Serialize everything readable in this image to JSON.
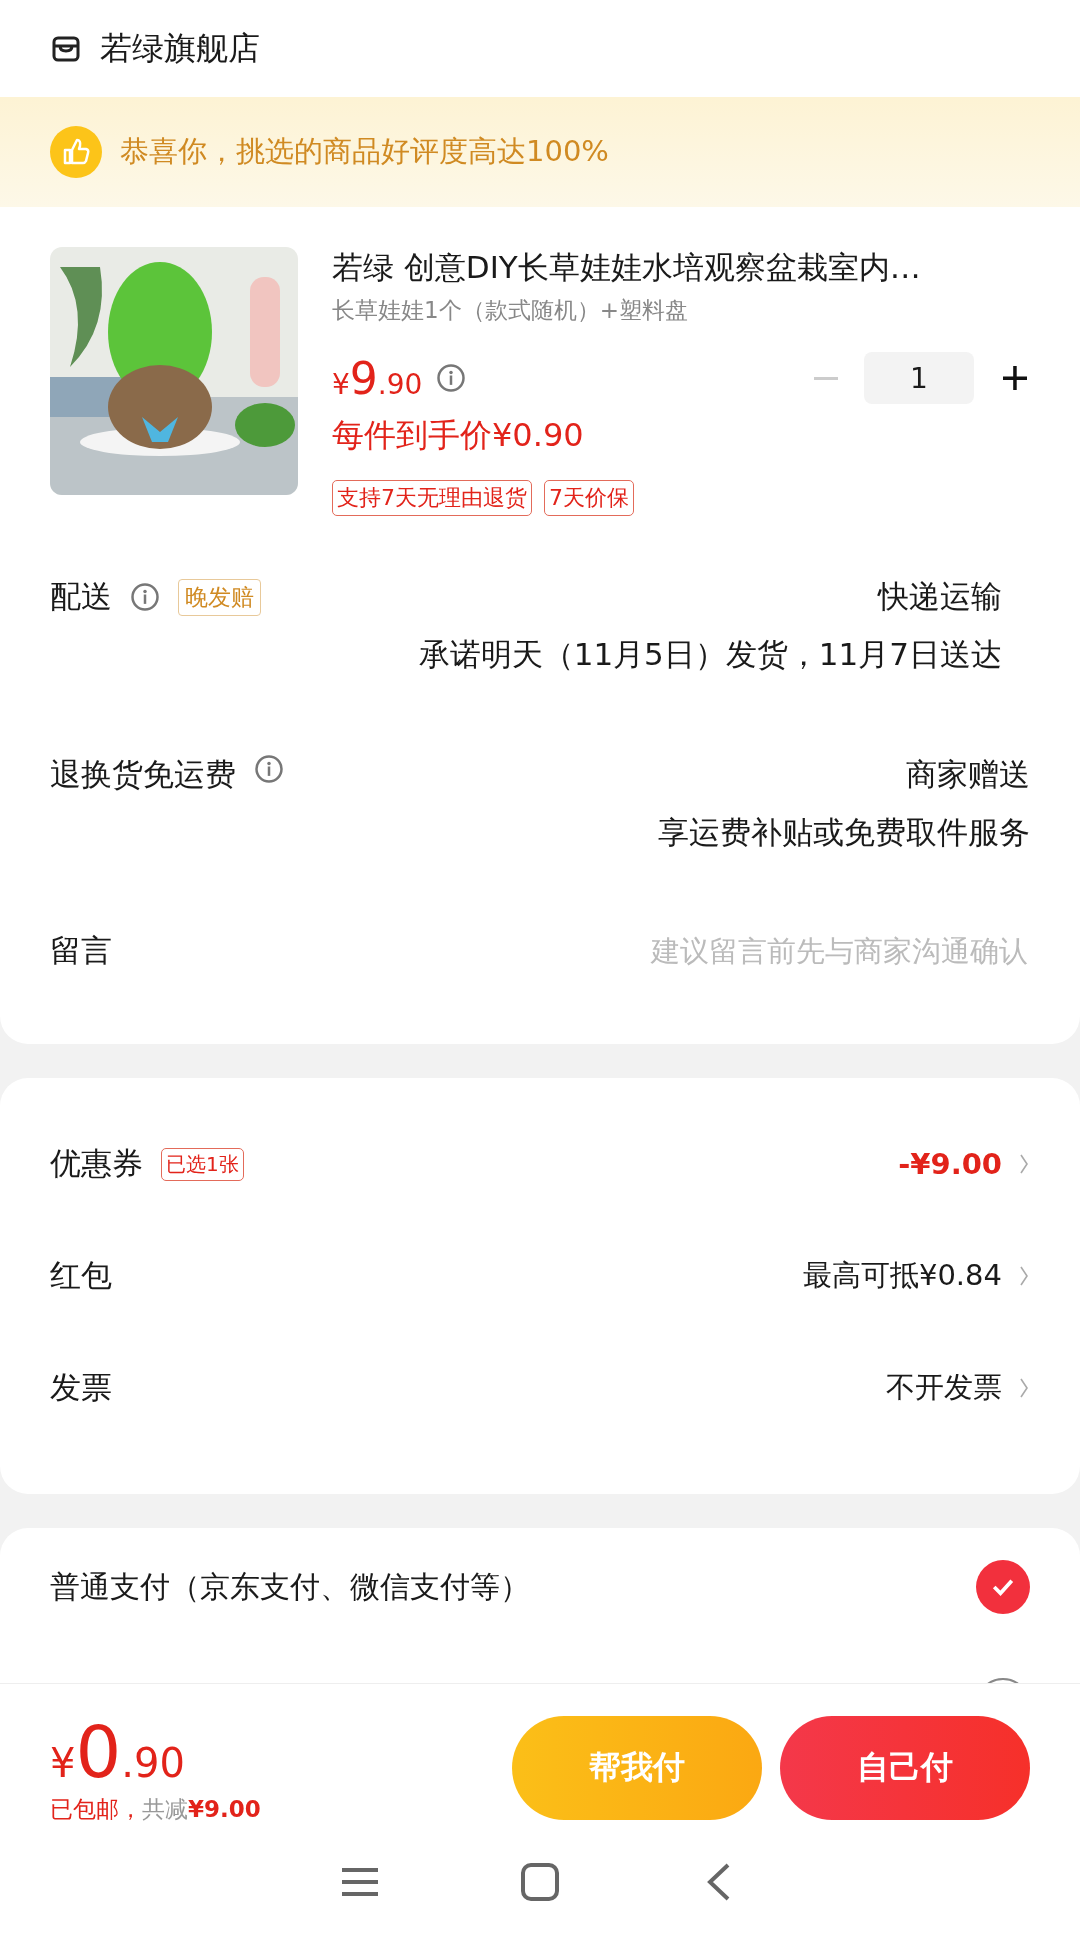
{
  "store": {
    "name": "若绿旗舰店"
  },
  "banner": {
    "text": "恭喜你，挑选的商品好评度高达100%"
  },
  "product": {
    "kind": "picture",
    "title": "若绿  创意DIY长草娃娃水培观察盆栽室内…",
    "variant": "长草娃娃1个（款式随机）+塑料盘",
    "currency": "¥",
    "price_int": "9",
    "price_dec": ".90",
    "unit_price": "每件到手价¥0.90",
    "quantity": "1",
    "tags": [
      "支持7天无理由退货",
      "7天价保"
    ]
  },
  "delivery": {
    "label": "配送",
    "badge": "晚发赔",
    "method": "快递运输",
    "promise": "承诺明天（11月5日）发货，11月7日送达"
  },
  "returns": {
    "label": "退换货免运费",
    "value": "商家赠送",
    "note": "享运费补贴或免费取件服务"
  },
  "message": {
    "label": "留言",
    "placeholder": "建议留言前先与商家沟通确认"
  },
  "discounts": [
    {
      "label": "优惠券",
      "badge": "已选1张",
      "value": "-¥9.00",
      "kind": "red"
    },
    {
      "label": "红包",
      "value": "最高可抵¥0.84",
      "kind": "plain"
    },
    {
      "label": "发票",
      "value": "不开发票",
      "kind": "plain"
    }
  ],
  "payment_options": [
    {
      "label": "普通支付（京东支付、微信支付等）",
      "selected": true
    },
    {
      "selected": false
    }
  ],
  "footer": {
    "currency": "¥",
    "total_int": "0",
    "total_dec": ".90",
    "shipping": "已包邮，",
    "saved_label": "共减",
    "saved_amount": "¥9.00",
    "buttons": [
      {
        "label": "帮我付",
        "kind": "secondary"
      },
      {
        "label": "自己付",
        "kind": "primary"
      }
    ]
  }
}
